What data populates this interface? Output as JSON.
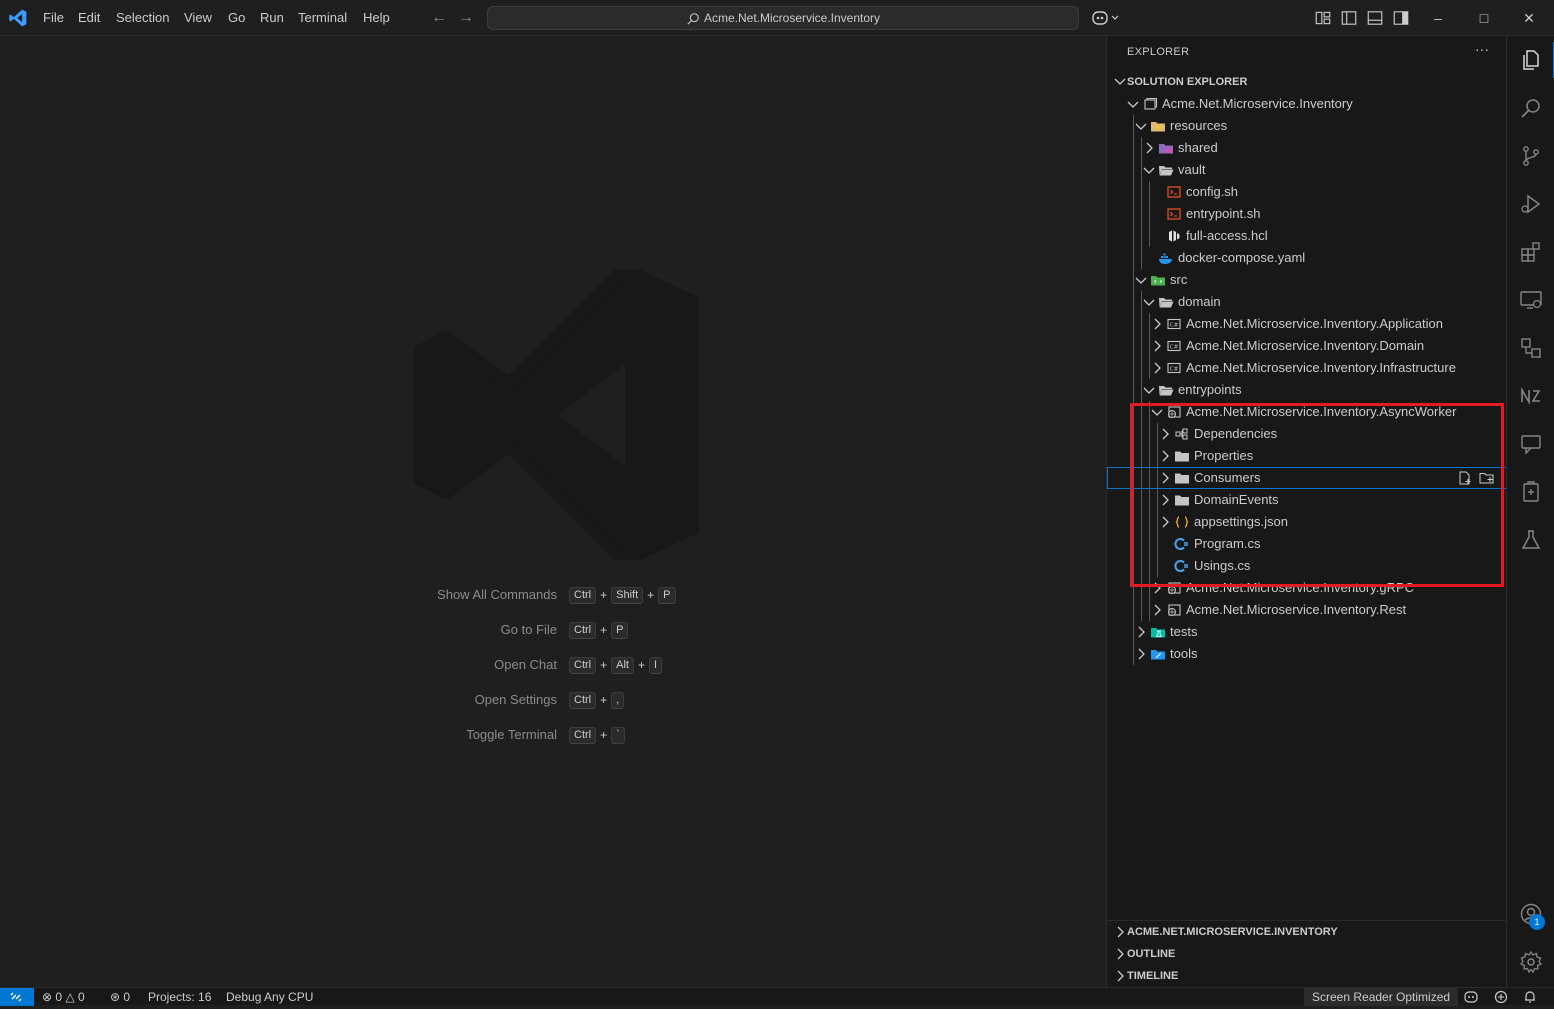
{
  "menu": [
    "File",
    "Edit",
    "Selection",
    "View",
    "Go",
    "Run",
    "Terminal",
    "Help"
  ],
  "command_center": {
    "text": "Acme.Net.Microservice.Inventory"
  },
  "window_controls": {
    "minimize": "–",
    "maximize": "□",
    "close": "✕"
  },
  "editor": {
    "hints": [
      {
        "label": "Show All Commands",
        "keys": [
          "Ctrl",
          "Shift",
          "P"
        ]
      },
      {
        "label": "Go to File",
        "keys": [
          "Ctrl",
          "P"
        ]
      },
      {
        "label": "Open Chat",
        "keys": [
          "Ctrl",
          "Alt",
          "I"
        ]
      },
      {
        "label": "Open Settings",
        "keys": [
          "Ctrl",
          ","
        ]
      },
      {
        "label": "Toggle Terminal",
        "keys": [
          "Ctrl",
          "`"
        ]
      }
    ]
  },
  "sidebar": {
    "title": "EXPLORER",
    "more": "···",
    "section": "SOLUTION EXPLORER",
    "tree": [
      {
        "label": "Acme.Net.Microservice.Inventory",
        "depth": 0,
        "expanded": true,
        "icon": "solution-icon"
      },
      {
        "label": "resources",
        "depth": 1,
        "expanded": true,
        "icon": "folder-resources-icon"
      },
      {
        "label": "shared",
        "depth": 2,
        "expanded": false,
        "icon": "folder-shared-icon"
      },
      {
        "label": "vault",
        "depth": 2,
        "expanded": true,
        "icon": "folder-open-icon"
      },
      {
        "label": "config.sh",
        "depth": 3,
        "icon": "shell-file-icon"
      },
      {
        "label": "entrypoint.sh",
        "depth": 3,
        "icon": "shell-file-icon"
      },
      {
        "label": "full-access.hcl",
        "depth": 3,
        "icon": "hcl-file-icon"
      },
      {
        "label": "docker-compose.yaml",
        "depth": 2,
        "icon": "docker-icon"
      },
      {
        "label": "src",
        "depth": 1,
        "expanded": true,
        "icon": "folder-src-icon"
      },
      {
        "label": "domain",
        "depth": 2,
        "expanded": true,
        "icon": "folder-open-icon"
      },
      {
        "label": "Acme.Net.Microservice.Inventory.Application",
        "depth": 3,
        "expanded": false,
        "icon": "csproj-icon"
      },
      {
        "label": "Acme.Net.Microservice.Inventory.Domain",
        "depth": 3,
        "expanded": false,
        "icon": "csproj-icon"
      },
      {
        "label": "Acme.Net.Microservice.Inventory.Infrastructure",
        "depth": 3,
        "expanded": false,
        "icon": "csproj-icon"
      },
      {
        "label": "entrypoints",
        "depth": 2,
        "expanded": true,
        "icon": "folder-open-icon"
      },
      {
        "label": "Acme.Net.Microservice.Inventory.AsyncWorker",
        "depth": 3,
        "expanded": true,
        "icon": "web-project-icon"
      },
      {
        "label": "Dependencies",
        "depth": 4,
        "expanded": false,
        "icon": "dependencies-icon"
      },
      {
        "label": "Properties",
        "depth": 4,
        "expanded": false,
        "icon": "folder-icon"
      },
      {
        "label": "Consumers",
        "depth": 4,
        "expanded": false,
        "icon": "folder-icon",
        "focused": true
      },
      {
        "label": "DomainEvents",
        "depth": 4,
        "expanded": false,
        "icon": "folder-icon"
      },
      {
        "label": "appsettings.json",
        "depth": 4,
        "expanded": false,
        "icon": "json-icon"
      },
      {
        "label": "Program.cs",
        "depth": 4,
        "icon": "csharp-icon"
      },
      {
        "label": "Usings.cs",
        "depth": 4,
        "icon": "csharp-icon"
      },
      {
        "label": "Acme.Net.Microservice.Inventory.gRPC",
        "depth": 3,
        "expanded": false,
        "icon": "web-project-icon"
      },
      {
        "label": "Acme.Net.Microservice.Inventory.Rest",
        "depth": 3,
        "expanded": false,
        "icon": "web-project-icon"
      },
      {
        "label": "tests",
        "depth": 1,
        "expanded": false,
        "icon": "folder-tests-icon"
      },
      {
        "label": "tools",
        "depth": 1,
        "expanded": false,
        "icon": "folder-tools-icon"
      }
    ],
    "bottom_sections": [
      "ACME.NET.MICROSERVICE.INVENTORY",
      "OUTLINE",
      "TIMELINE"
    ]
  },
  "activity_badge": "1",
  "statusbar": {
    "errors": "0",
    "warnings": "0",
    "ports": "0",
    "projects": "Projects: 16",
    "config": "Debug Any CPU",
    "screen_reader": "Screen Reader Optimized"
  },
  "colors": {
    "accent": "#0078d4",
    "highlight_box": "#e51b24",
    "folder": "#dcb67a"
  }
}
